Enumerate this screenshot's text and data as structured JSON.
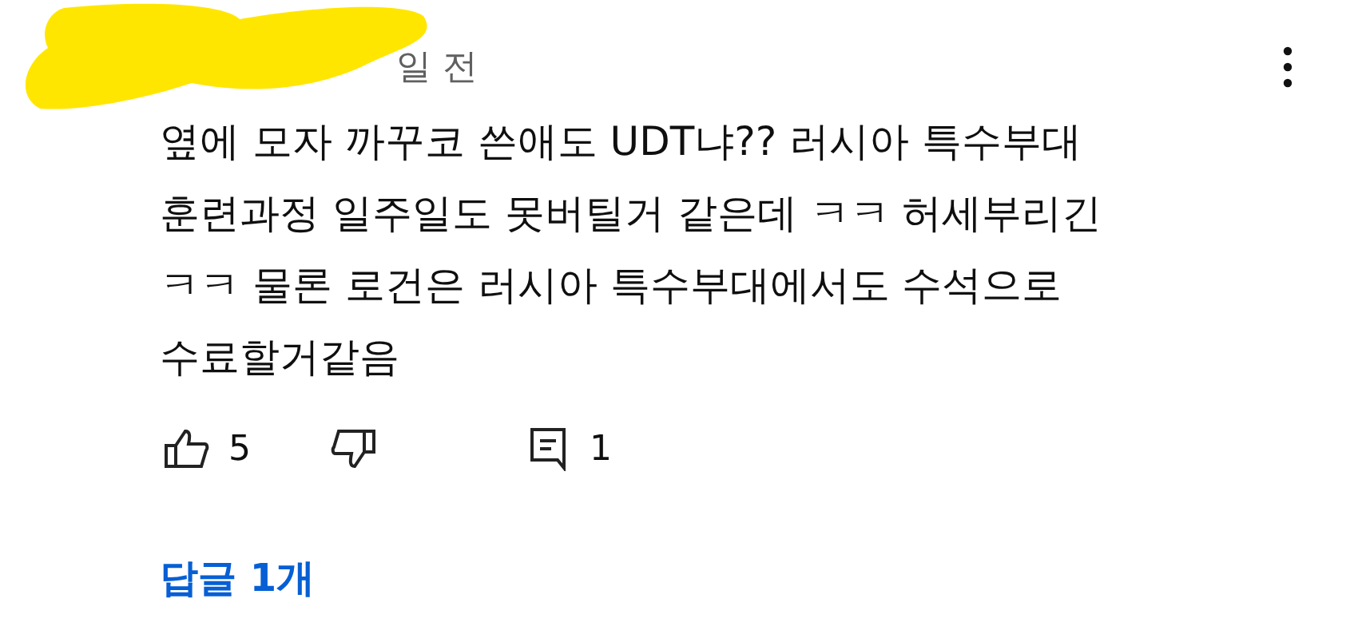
{
  "comment": {
    "time": "일 전",
    "lines": [
      "옆에 모자 까꾸코 쓴애도 UDT냐?? 러시아 특수부대",
      "훈련과정 일주일도 못버틸거 같은데 ㅋㅋ 허세부리긴",
      "ㅋㅋ 물론 로건은 러시아 특수부대에서도 수석으로",
      "수료할거같음"
    ],
    "likes": "5",
    "replies_count": "1",
    "reply_link": "답글 1개"
  }
}
